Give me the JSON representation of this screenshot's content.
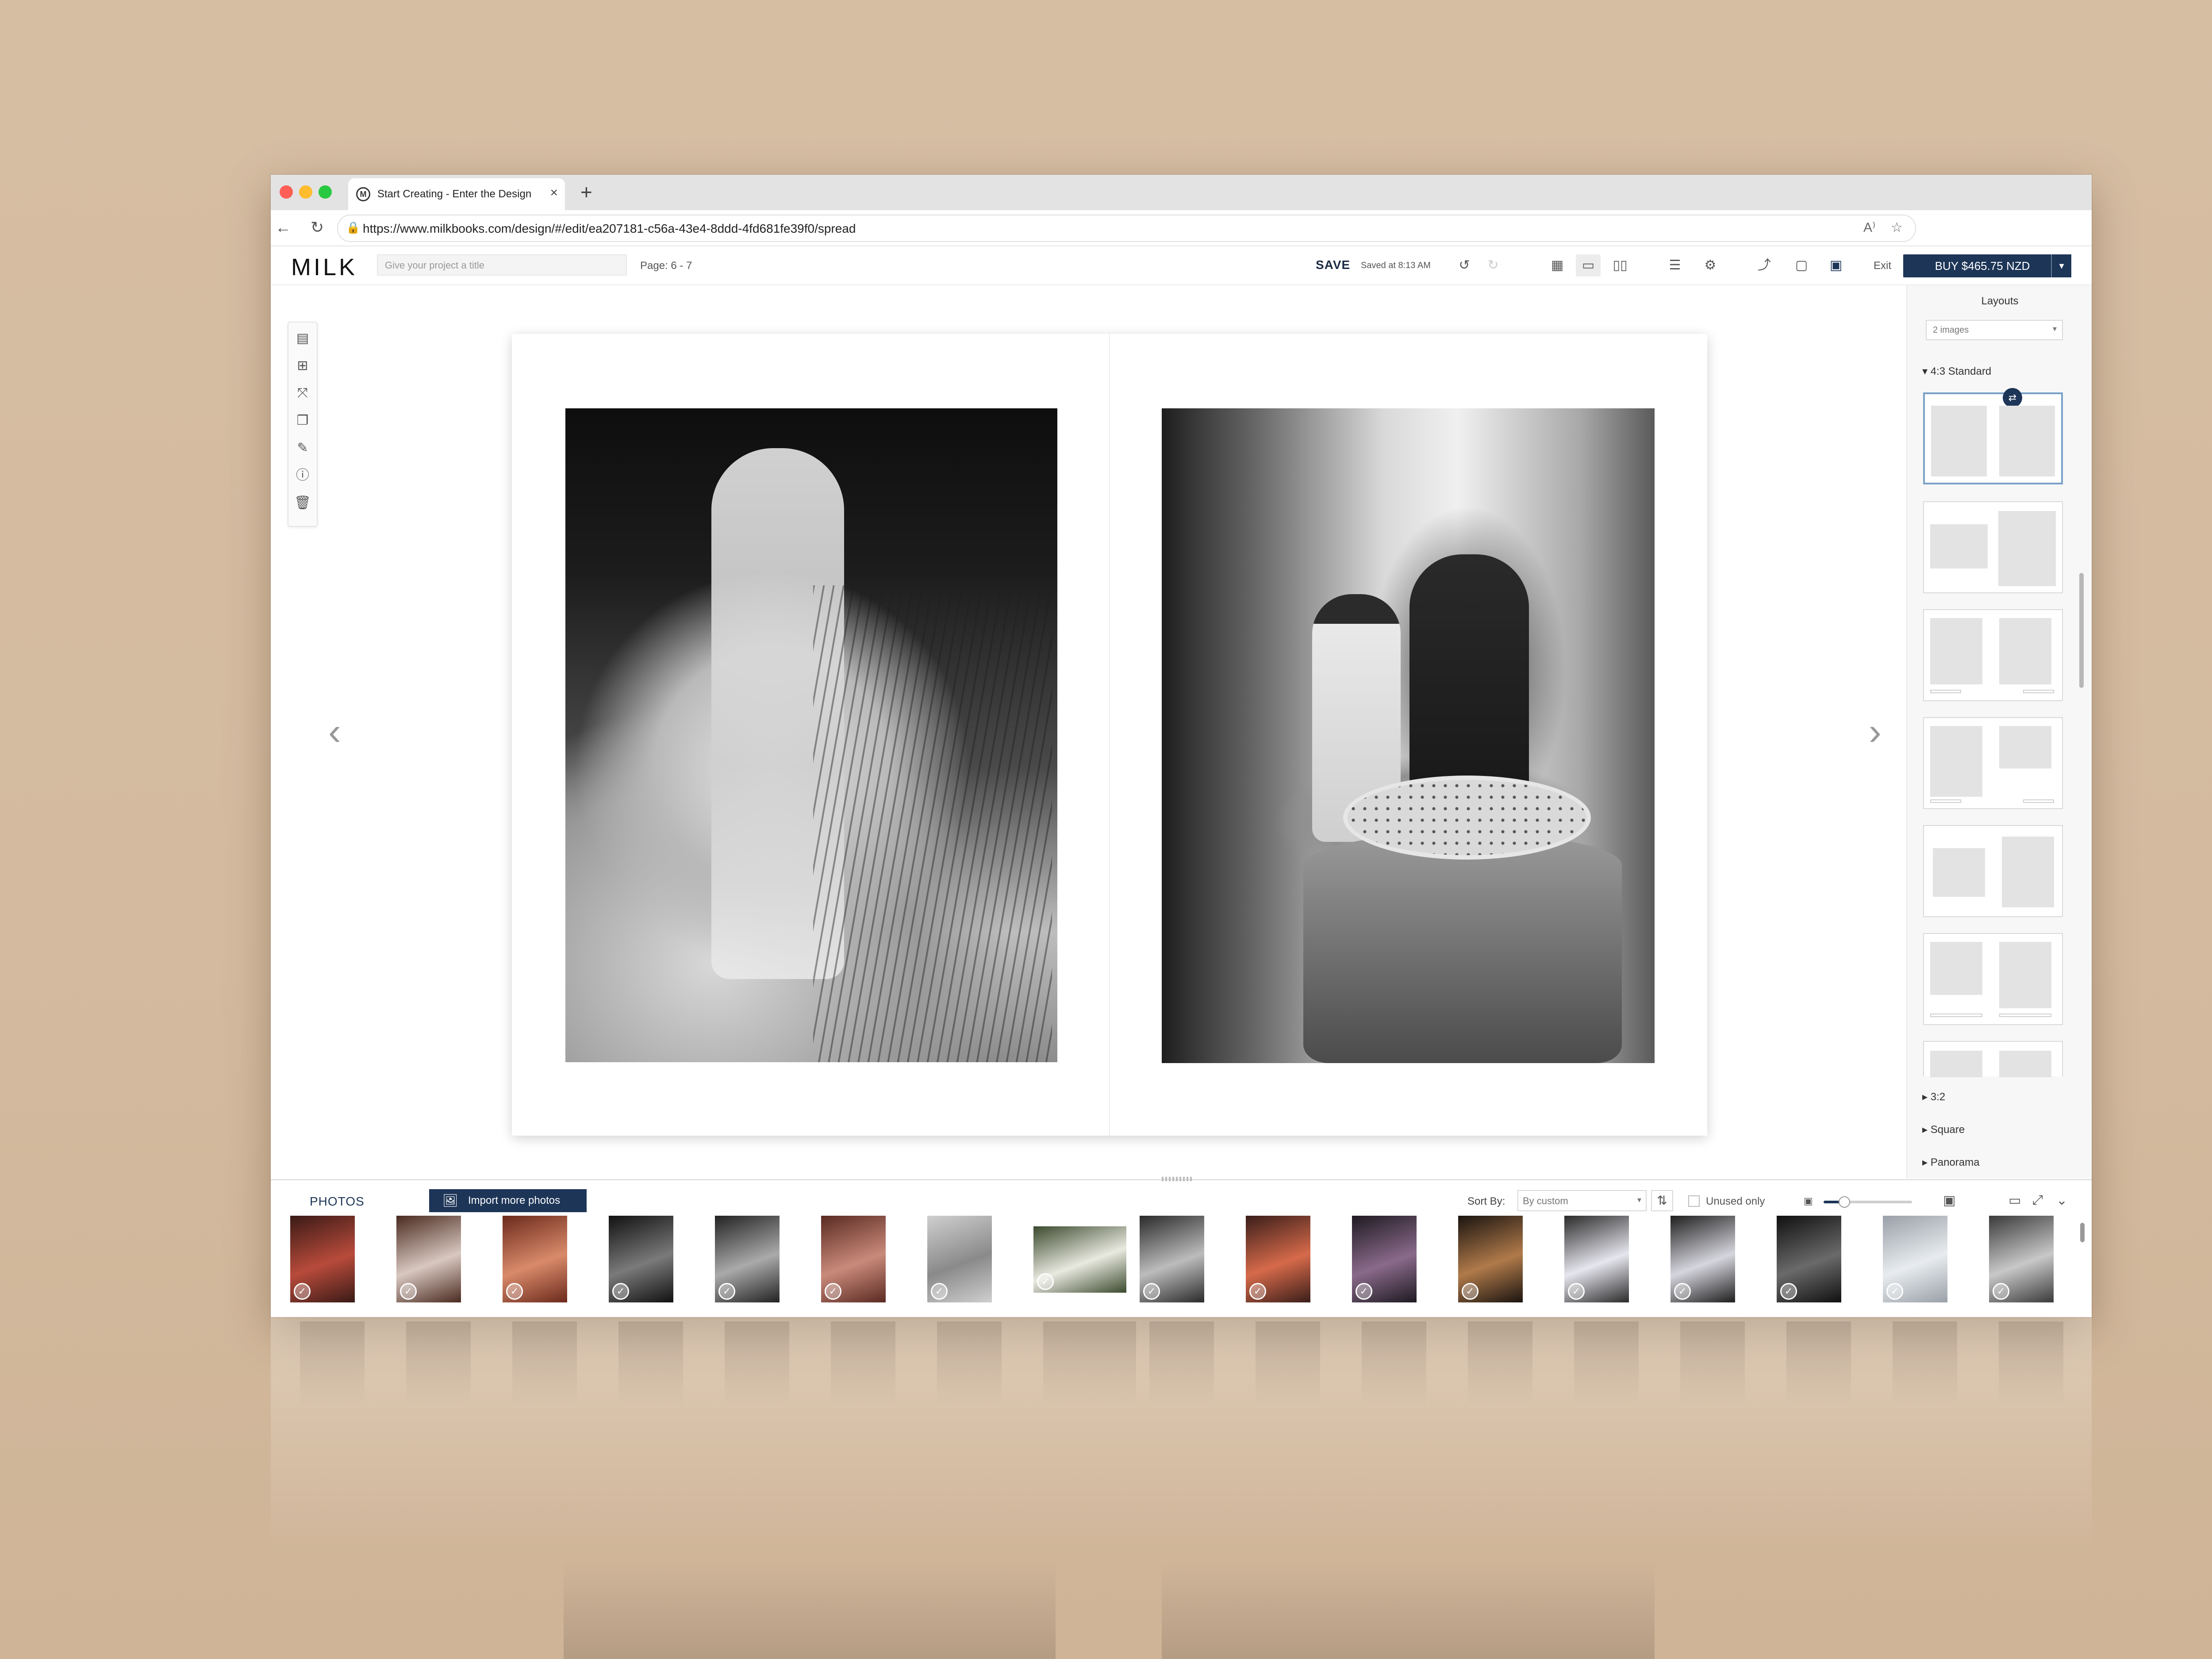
{
  "browser": {
    "tab_title": "Start Creating - Enter the Design",
    "favicon_letter": "M",
    "url": "https://www.milkbooks.com/design/#/edit/ea207181-c56a-43e4-8ddd-4fd681fe39f0/spread"
  },
  "header": {
    "logo": "MILK",
    "project_title_placeholder": "Give your project a title",
    "page_label": "Page: 6 - 7",
    "save_label": "SAVE",
    "saved_status": "Saved at 8:13 AM",
    "exit_label": "Exit",
    "buy_label": "BUY $465.75 NZD"
  },
  "layouts_panel": {
    "title": "Layouts",
    "images_filter": "2 images",
    "sections": [
      {
        "label": "4:3 Standard",
        "expanded": true
      },
      {
        "label": "3:2",
        "expanded": false
      },
      {
        "label": "Square",
        "expanded": false
      },
      {
        "label": "Panorama",
        "expanded": false
      }
    ],
    "selected_layout_index": 0
  },
  "photos_bar": {
    "tab_label": "PHOTOS",
    "import_label": "Import more photos",
    "sort_label": "Sort By:",
    "sort_value": "By custom",
    "unused_only_label": "Unused only",
    "thumbnail_count": 17
  },
  "colors": {
    "brand_navy": "#1d3557",
    "backdrop": "#d6bea3",
    "selected_layout_border": "#7aa1c7"
  }
}
